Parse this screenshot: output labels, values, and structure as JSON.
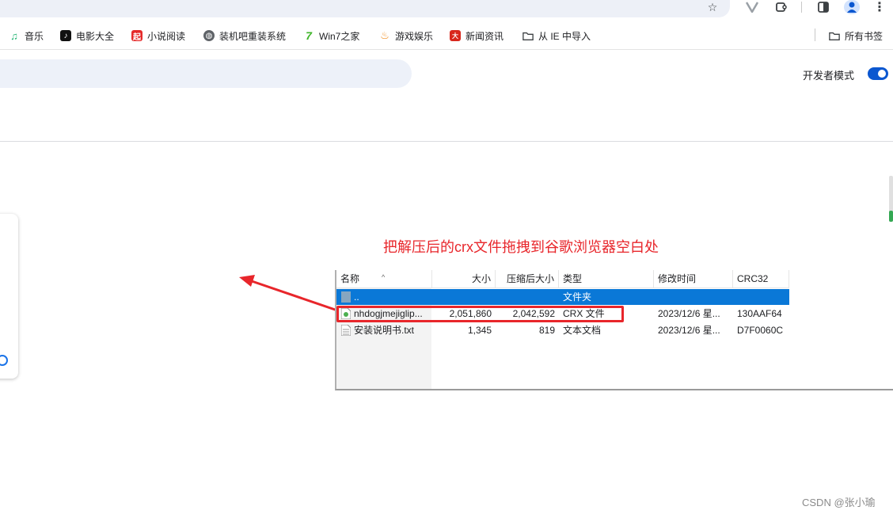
{
  "bookmarks": {
    "items": [
      {
        "label": "音乐",
        "icon": "music-icon",
        "color": "#22b573"
      },
      {
        "label": "电影大全",
        "icon": "tiktok-icon",
        "color": "#111111"
      },
      {
        "label": "小说阅读",
        "icon": "novel-icon",
        "color": "#e52a2a"
      },
      {
        "label": "装机吧重装系统",
        "icon": "globe-icon",
        "color": "#5f6368"
      },
      {
        "label": "Win7之家",
        "icon": "win7-icon",
        "color": "#3fb529"
      },
      {
        "label": "游戏娱乐",
        "icon": "flame-icon",
        "color": "#f08c1e"
      },
      {
        "label": "新闻资讯",
        "icon": "news-icon",
        "color": "#d8271c"
      },
      {
        "label": "从 IE 中导入",
        "icon": "folder-icon",
        "color": "#5f6368"
      }
    ],
    "all_bookmarks": "所有书签"
  },
  "header": {
    "dev_mode_label": "开发者模式",
    "dev_mode_on": true,
    "toggle_color": "#0b57d0"
  },
  "instruction": "把解压后的crx文件拖拽到谷歌浏览器空白处",
  "archive": {
    "columns": [
      "名称",
      "大小",
      "压缩后大小",
      "类型",
      "修改时间",
      "CRC32"
    ],
    "rows": [
      {
        "name": "..",
        "size": "",
        "packed": "",
        "type": "文件夹",
        "modified": "",
        "crc": "",
        "selected": true,
        "icon": "folder-up-icon"
      },
      {
        "name": "nhdogjmejiglip...",
        "size": "2,051,860",
        "packed": "2,042,592",
        "type": "CRX 文件",
        "modified": "2023/12/6 星...",
        "crc": "130AAF64",
        "selected": false,
        "icon": "crx-file-icon"
      },
      {
        "name": "安装说明书.txt",
        "size": "1,345",
        "packed": "819",
        "type": "文本文档",
        "modified": "2023/12/6 星...",
        "crc": "D7F0060C",
        "selected": false,
        "icon": "text-file-icon"
      }
    ]
  },
  "watermark": "CSDN @张小瑜",
  "colors": {
    "accent_red": "#e8262b",
    "selection_blue": "#0a78d7"
  }
}
